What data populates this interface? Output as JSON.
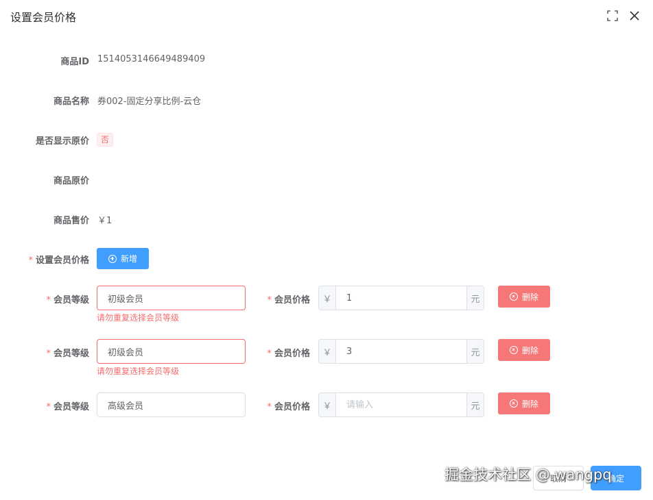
{
  "dialog": {
    "title": "设置会员价格"
  },
  "header_icons": {
    "fullscreen": "fullscreen-icon",
    "close": "close-icon"
  },
  "fields": {
    "product_id": {
      "label": "商品ID",
      "value": "1514053146649489409"
    },
    "product_name": {
      "label": "商品名称",
      "value": "券002-固定分享比例-云仓"
    },
    "show_original": {
      "label": "是否显示原价",
      "value": "否"
    },
    "original_price": {
      "label": "商品原价",
      "value": ""
    },
    "sale_price": {
      "label": "商品售价",
      "value": "￥1"
    },
    "member_price": {
      "label": "设置会员价格",
      "add_button": "新增"
    }
  },
  "member_rows": [
    {
      "level_label": "会员等级",
      "level": "初级会员",
      "price_label": "会员价格",
      "prefix": "￥",
      "price": "1",
      "placeholder": "请输入",
      "suffix": "元",
      "error": "请勿重复选择会员等级",
      "delete": "删除"
    },
    {
      "level_label": "会员等级",
      "level": "初级会员",
      "price_label": "会员价格",
      "prefix": "￥",
      "price": "3",
      "placeholder": "请输入",
      "suffix": "元",
      "error": "请勿重复选择会员等级",
      "delete": "删除"
    },
    {
      "level_label": "会员等级",
      "level": "高级会员",
      "price_label": "会员价格",
      "prefix": "￥",
      "price": "",
      "placeholder": "请输入",
      "suffix": "元",
      "error": "",
      "delete": "删除"
    }
  ],
  "footer": {
    "cancel": "取消",
    "confirm": "确定"
  },
  "watermark": "掘金技术社区 @ wangpq",
  "colors": {
    "primary": "#409eff",
    "danger": "#f56c6c",
    "required": "#f56c6c"
  }
}
